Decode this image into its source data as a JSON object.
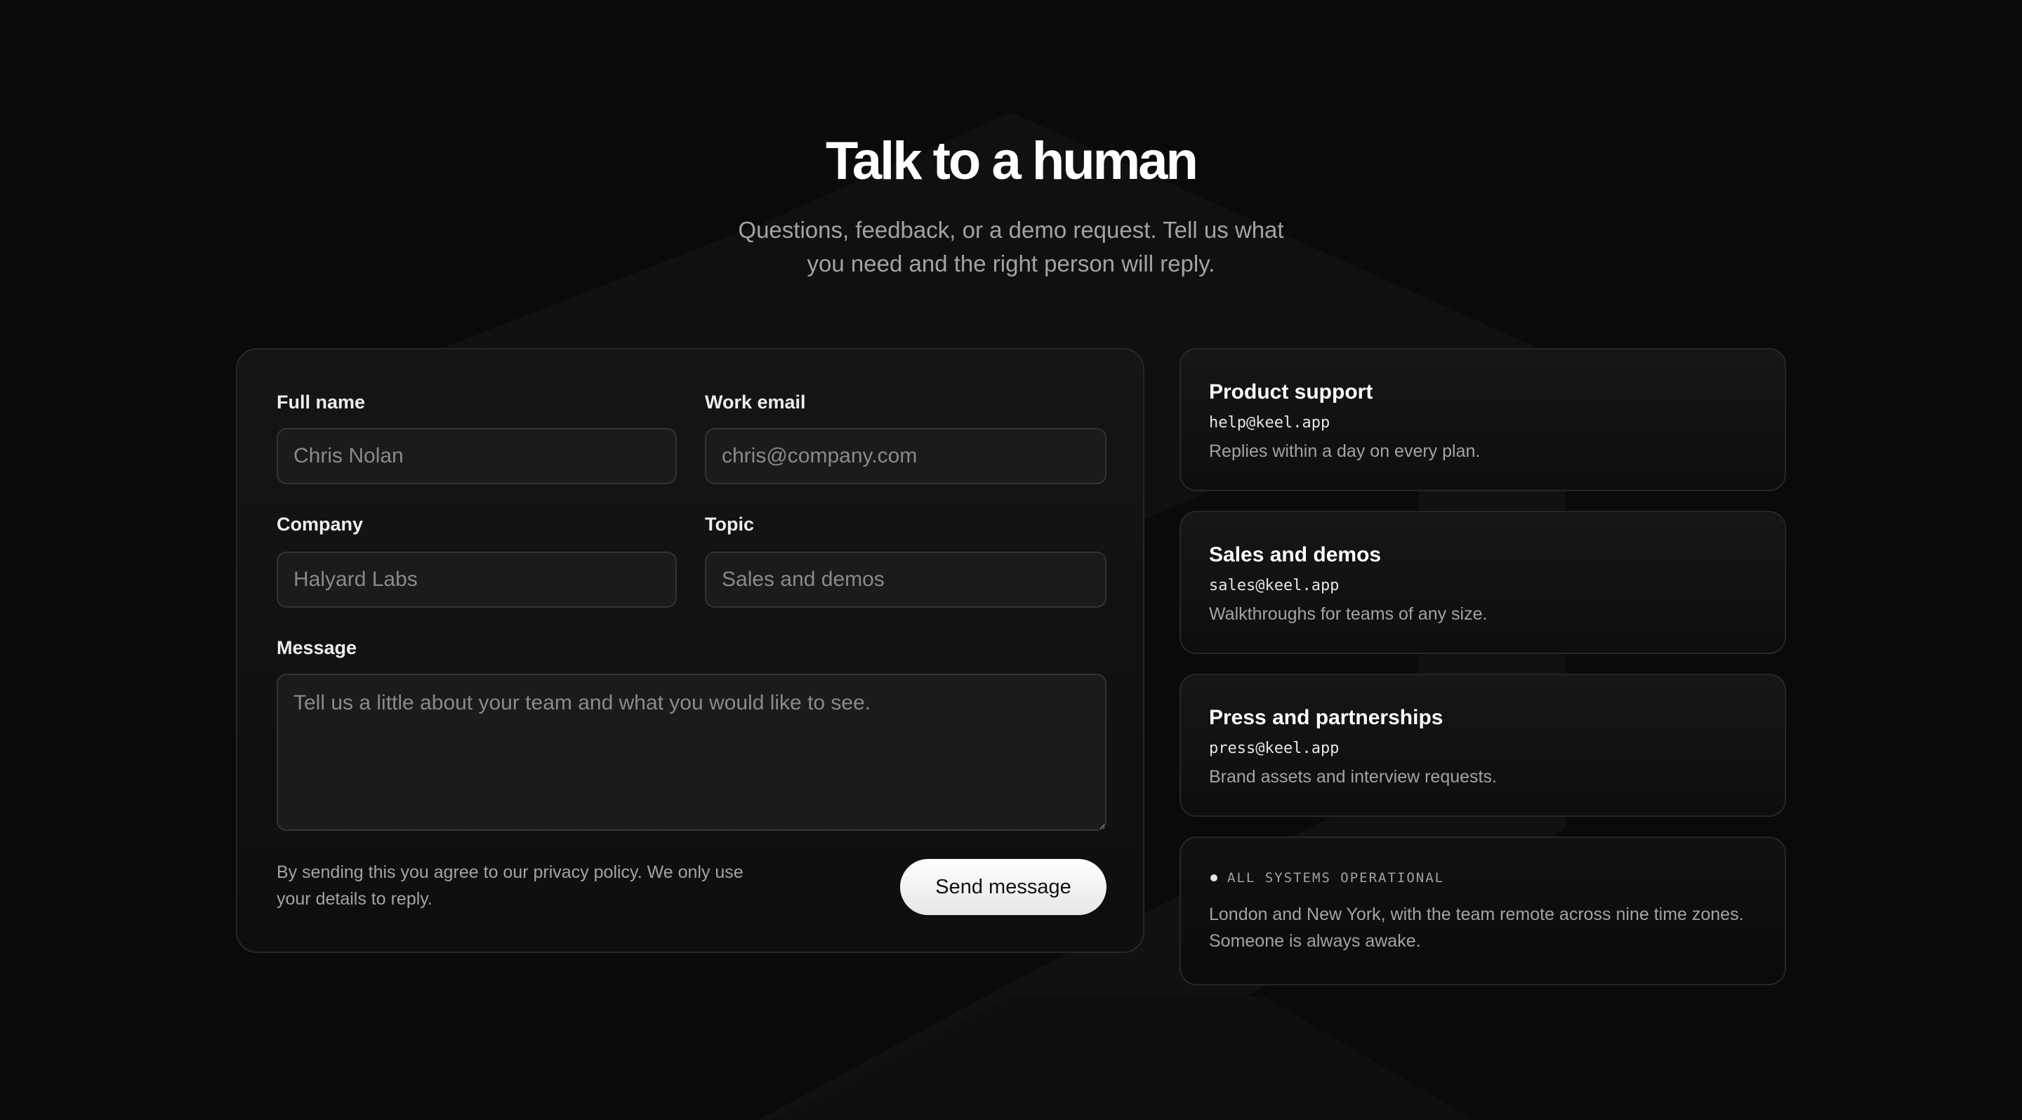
{
  "hero": {
    "title": "Talk to a human",
    "subtitle": "Questions, feedback, or a demo request. Tell us what you need and the right person will reply."
  },
  "form": {
    "full_name": {
      "label": "Full name",
      "placeholder": "Chris Nolan"
    },
    "work_email": {
      "label": "Work email",
      "placeholder": "chris@company.com"
    },
    "company": {
      "label": "Company",
      "placeholder": "Halyard Labs"
    },
    "topic": {
      "label": "Topic",
      "placeholder": "Sales and demos"
    },
    "message": {
      "label": "Message",
      "placeholder": "Tell us a little about your team and what you would like to see."
    },
    "privacy_note": "By sending this you agree to our privacy policy. We only use your details to reply.",
    "send_label": "Send message"
  },
  "contacts": [
    {
      "title": "Product support",
      "email": "help@keel.app",
      "description": "Replies within a day on every plan."
    },
    {
      "title": "Sales and demos",
      "email": "sales@keel.app",
      "description": "Walkthroughs for teams of any size."
    },
    {
      "title": "Press and partnerships",
      "email": "press@keel.app",
      "description": "Brand assets and interview requests."
    }
  ],
  "status": {
    "label": "ALL SYSTEMS OPERATIONAL",
    "text": "London and New York, with the team remote across nine time zones. Someone is always awake."
  },
  "colors": {
    "background": "#0a0a0a",
    "card": "#151515",
    "border": "#262626",
    "text_primary": "#ffffff",
    "text_muted": "#a3a3a3",
    "button": "#ffffff"
  }
}
